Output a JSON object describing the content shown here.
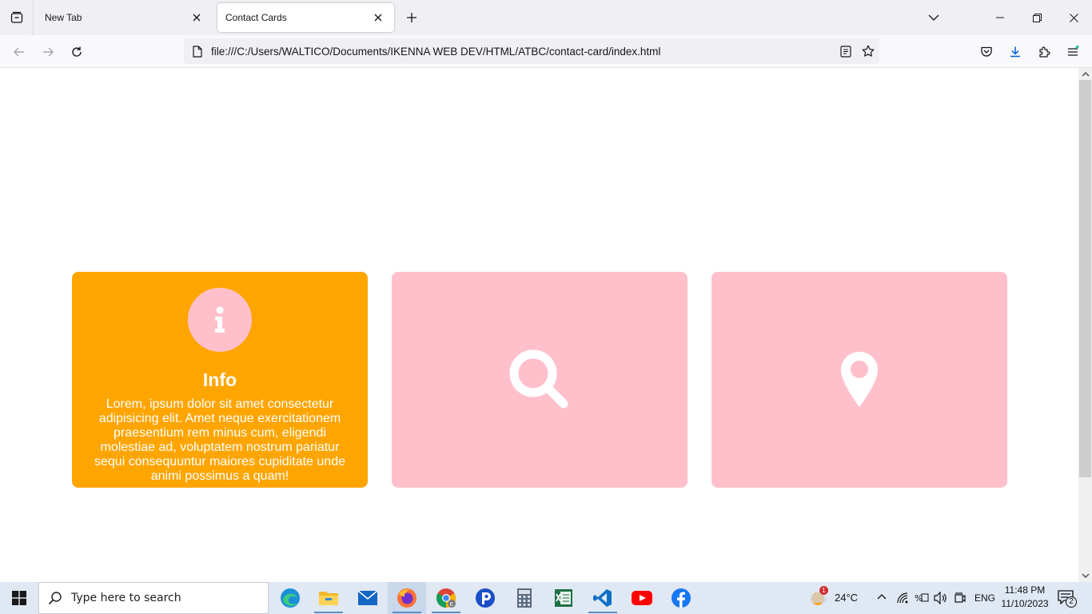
{
  "browser": {
    "tabs": [
      {
        "title": "New Tab",
        "active": false
      },
      {
        "title": "Contact Cards",
        "active": true
      }
    ],
    "url": "file:///C:/Users/WALTICO/Documents/IKENNA WEB DEV/HTML/ATBC/contact-card/index.html"
  },
  "cards": [
    {
      "icon": "info-icon",
      "title": "Info",
      "text": "Lorem, ipsum dolor sit amet consectetur adipisicing elit. Amet neque exercitationem praesentium rem minus cum, eligendi molestiae ad, voluptatem nostrum pariatur sequi consequuntur maiores cupiditate unde animi possimus a quam!",
      "color": "#ffa500"
    },
    {
      "icon": "search-icon",
      "color": "#ffc0cb"
    },
    {
      "icon": "location-pin-icon",
      "color": "#ffc0cb"
    }
  ],
  "taskbar": {
    "search_placeholder": "Type here to search",
    "apps": [
      "edge-icon",
      "file-explorer-icon",
      "mail-icon",
      "firefox-icon",
      "chrome-icon",
      "pockets-icon",
      "calculator-icon",
      "excel-icon",
      "vscode-icon",
      "youtube-icon",
      "facebook-icon"
    ],
    "weather": {
      "badge": "1",
      "temperature": "24°C"
    },
    "language": "ENG",
    "time": "11:48 PM",
    "date": "11/10/2023",
    "notifications": "2"
  }
}
